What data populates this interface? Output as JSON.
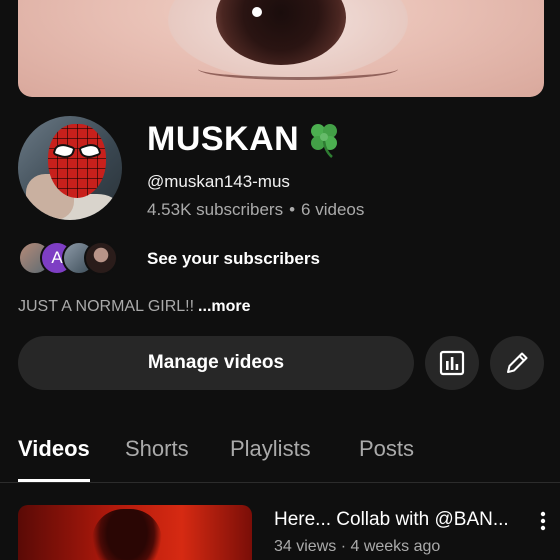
{
  "channel": {
    "name": "MUSKAN",
    "emoji": "🍀",
    "handle": "@muskan143-mus",
    "subscribers": "4.53K subscribers",
    "separator": "•",
    "videos": "6 videos"
  },
  "subscribers_preview": {
    "avatar_letter": "A",
    "label": "See your subscribers"
  },
  "description": {
    "text": "JUST A NORMAL GIRL!!",
    "more_label": "...more"
  },
  "actions": {
    "manage_label": "Manage videos",
    "analytics_icon": "analytics-icon",
    "edit_icon": "pencil-icon"
  },
  "tabs": [
    {
      "label": "Videos",
      "active": true
    },
    {
      "label": "Shorts",
      "active": false
    },
    {
      "label": "Playlists",
      "active": false
    },
    {
      "label": "Posts",
      "active": false
    }
  ],
  "videos": [
    {
      "title": "Here... Collab with @BAN...",
      "meta": "34 views · 4 weeks ago"
    }
  ],
  "colors": {
    "background": "#0f0f0f",
    "button": "#272727",
    "secondary_text": "#aaaaaa",
    "accent_purple": "#7e3ec4"
  }
}
